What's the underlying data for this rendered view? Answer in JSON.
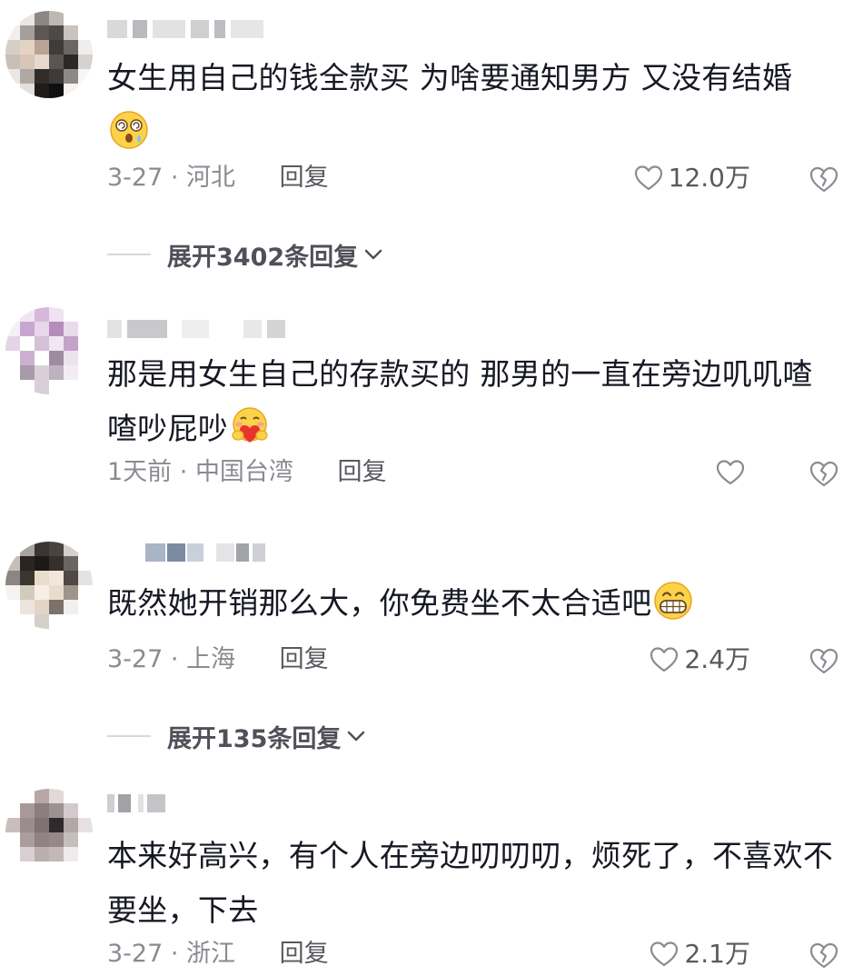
{
  "comments": [
    {
      "text": "女生用自己的钱全款买 为啥要通知男方 又没有结婚",
      "emoji": "dizzy-face-emoji",
      "date": "3-27",
      "location": "河北",
      "reply_label": "回复",
      "likes": "12.0万",
      "expand_label": "展开3402条回复"
    },
    {
      "text": "那是用女生自己的存款买的 那男的一直在旁边叽叽喳喳吵屁吵",
      "emoji": "heart-hug-emoji",
      "date": "1天前",
      "location": "中国台湾",
      "reply_label": "回复",
      "likes": ""
    },
    {
      "text": "既然她开销那么大，你免费坐不太合适吧",
      "emoji": "grin-emoji",
      "date": "3-27",
      "location": "上海",
      "reply_label": "回复",
      "likes": "2.4万",
      "expand_label": "展开135条回复"
    },
    {
      "text": "本来好高兴，有个人在旁边叨叨叨，烦死了，不喜欢不要坐，下去",
      "date": "3-27",
      "location": "浙江",
      "reply_label": "回复",
      "likes": "2.1万"
    }
  ],
  "colors": {
    "text": "#161823",
    "meta": "#8a8b91",
    "icon": "#8a8b91"
  }
}
